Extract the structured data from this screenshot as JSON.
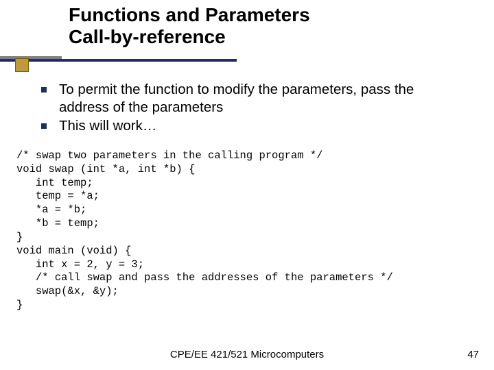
{
  "title": {
    "line1": "Functions and Parameters",
    "line2": "Call-by-reference"
  },
  "bullets": [
    "To permit the function to modify the parameters, pass the address of the parameters",
    "This will work…"
  ],
  "code": "/* swap two parameters in the calling program */\nvoid swap (int *a, int *b) {\n   int temp;\n   temp = *a;\n   *a = *b;\n   *b = temp;\n}\nvoid main (void) {\n   int x = 2, y = 3;\n   /* call swap and pass the addresses of the parameters */\n   swap(&x, &y);\n}",
  "footer": {
    "center": "CPE/EE 421/521 Microcomputers",
    "page": "47"
  }
}
